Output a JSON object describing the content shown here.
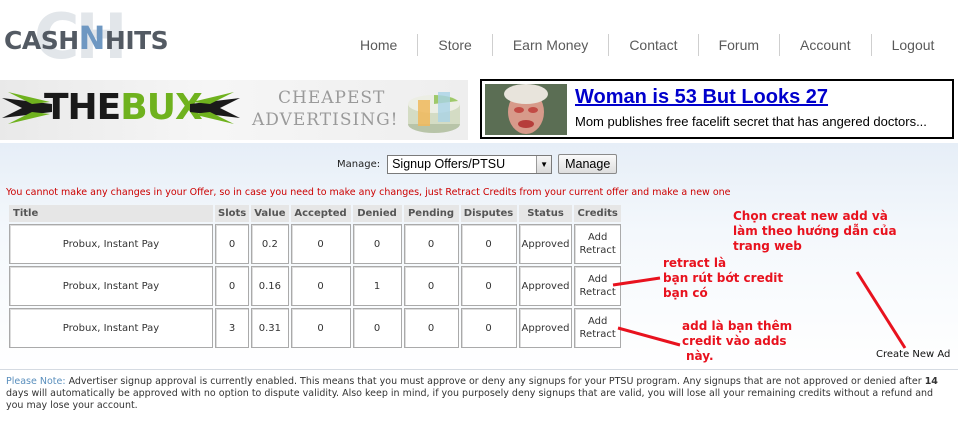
{
  "site": {
    "logo_left": "CASH",
    "logo_n": "N",
    "logo_right": "HITS",
    "logo_bg": "CH"
  },
  "nav": {
    "home": "Home",
    "store": "Store",
    "earn_money": "Earn Money",
    "contact": "Contact",
    "forum": "Forum",
    "account": "Account",
    "logout": "Logout"
  },
  "banners": {
    "bux_name_black": "THE",
    "bux_name_green": "BUX",
    "bux_tagline_1": "CHEAPEST",
    "bux_tagline_2": "ADVERTISING!",
    "ad_headline": "Woman is 53 But Looks 27",
    "ad_subtext": "Mom publishes free facelift secret that has angered doctors..."
  },
  "manage": {
    "label": "Manage:",
    "selected_option": "Signup Offers/PTSU",
    "button": "Manage"
  },
  "warning": "You cannot make any changes in your Offer, so in case you need to make any changes, just Retract Credits from your current offer and make a new one",
  "table": {
    "headers": {
      "title": "Title",
      "slots": "Slots",
      "value": "Value",
      "accepted": "Accepted",
      "denied": "Denied",
      "pending": "Pending",
      "disputes": "Disputes",
      "status": "Status",
      "credits": "Credits"
    },
    "rows": [
      {
        "title": "Probux, Instant Pay",
        "slots": "0",
        "value": "0.2",
        "accepted": "0",
        "denied": "0",
        "pending": "0",
        "disputes": "0",
        "status": "Approved",
        "add": "Add",
        "retract": "Retract"
      },
      {
        "title": "Probux, Instant Pay",
        "slots": "0",
        "value": "0.16",
        "accepted": "0",
        "denied": "1",
        "pending": "0",
        "disputes": "0",
        "status": "Approved",
        "add": "Add",
        "retract": "Retract"
      },
      {
        "title": "Probux, Instant Pay",
        "slots": "3",
        "value": "0.31",
        "accepted": "0",
        "denied": "0",
        "pending": "0",
        "disputes": "0",
        "status": "Approved",
        "add": "Add",
        "retract": "Retract"
      }
    ]
  },
  "annotations": {
    "create_line1": "Chọn creat new add và",
    "create_line2": "làm theo hướng dẫn của",
    "create_line3": "trang web",
    "retract_line1": "retract là",
    "retract_line2": "bạn rút bớt credit",
    "retract_line3": "bạn có",
    "add_line1": "add là bạn thêm",
    "add_line2": "credit vào adds",
    "add_line3": "này.",
    "color": "#e8121e"
  },
  "create_new_ad": "Create New Ad",
  "note": {
    "label": "Please Note:",
    "text_before": " Advertiser signup approval is currently enabled. This means that you must approve or deny any signups for your PTSU program. Any signups that are not approved or denied after ",
    "days": "14",
    "text_after": " days will automatically be approved with no option to dispute validity. Also keep in mind, if you purposely deny signups that are valid, you will lose all your remaining credits without a refund and you may lose your account."
  },
  "colors": {
    "nav_text": "#5a5a5a",
    "panel_top": "#e6eef7",
    "warning": "#cc0000",
    "ad_headline": "#0000cc",
    "bux_green": "#6fb21e",
    "note_label": "#5a8fbd"
  }
}
